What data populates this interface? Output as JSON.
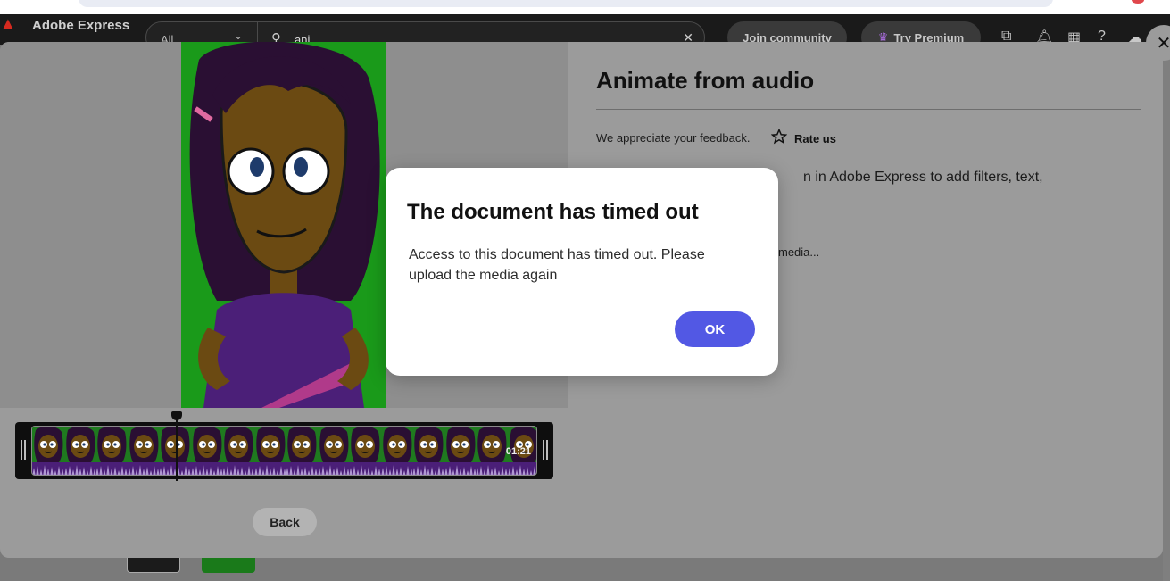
{
  "header": {
    "app_title": "Adobe Express",
    "search": {
      "filter": "All",
      "value": "ani"
    },
    "join_label": "Join community",
    "premium_label": "Try Premium"
  },
  "panel": {
    "title": "Animate from audio",
    "feedback_text": "We appreciate your feedback.",
    "rate_label": "Rate us",
    "body_fragment": "n in Adobe Express to add filters, text,",
    "small_fragment": "media..."
  },
  "timeline": {
    "duration": "01:21"
  },
  "back_label": "Back",
  "dialog": {
    "title": "The document has timed out",
    "body": "Access to this document has timed out. Please upload the media again",
    "ok_label": "OK"
  },
  "colors": {
    "accent": "#5258e4",
    "character_bg": "#1fb31f",
    "shirt": "#6b2aa3"
  },
  "icons": [
    "search-icon",
    "clear-icon",
    "crown-icon",
    "star-icon",
    "close-icon",
    "bell-icon",
    "apps-icon",
    "help-icon"
  ]
}
